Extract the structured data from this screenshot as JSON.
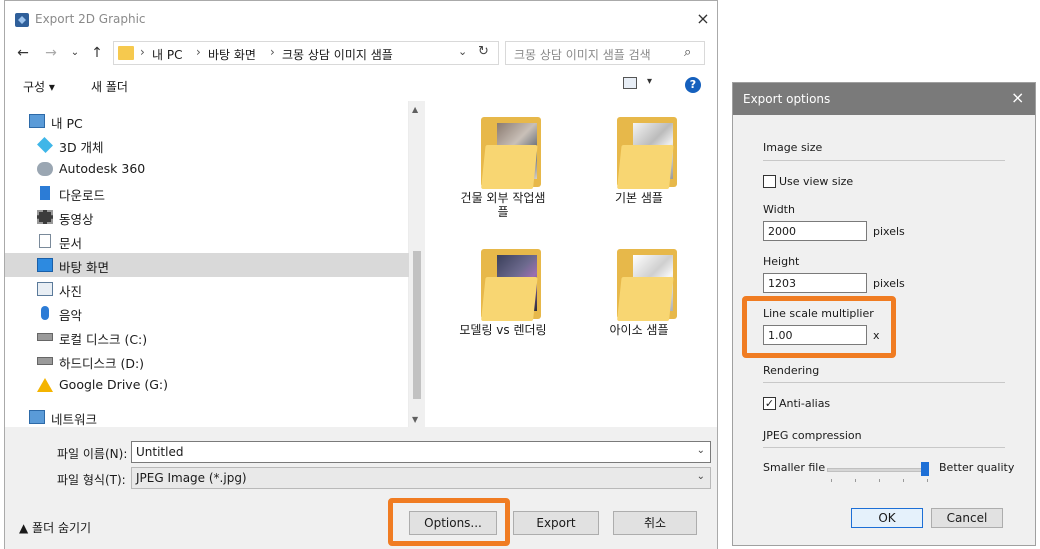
{
  "main_dialog": {
    "title": "Export 2D Graphic",
    "close_glyph": "×",
    "nav": {
      "back": "←",
      "forward": "→",
      "dropdown": "⌄",
      "up": "↑"
    },
    "address": {
      "crumbs": [
        "내 PC",
        "바탕 화면",
        "크몽 상담 이미지 샘플"
      ],
      "sep": "›",
      "dropdown": "⌄",
      "refresh": "↻"
    },
    "search_placeholder": "크몽 상담 이미지 샘플 검색",
    "search_icon": "⌕",
    "toolbar": {
      "organize": "구성 ▾",
      "new_folder": "새 폴더",
      "view_dropdown": "▾",
      "help": "?"
    },
    "sidebar": [
      {
        "label": "내 PC",
        "icon": "computer-icon"
      },
      {
        "label": "3D 개체",
        "icon": "cube-icon"
      },
      {
        "label": "Autodesk 360",
        "icon": "cloud-icon"
      },
      {
        "label": "다운로드",
        "icon": "download-icon"
      },
      {
        "label": "동영상",
        "icon": "video-icon"
      },
      {
        "label": "문서",
        "icon": "document-icon"
      },
      {
        "label": "바탕 화면",
        "icon": "desktop-icon"
      },
      {
        "label": "사진",
        "icon": "picture-icon"
      },
      {
        "label": "음악",
        "icon": "music-icon"
      },
      {
        "label": "로컬 디스크 (C:)",
        "icon": "disk-icon"
      },
      {
        "label": "하드디스크 (D:)",
        "icon": "disk-icon"
      },
      {
        "label": "Google Drive (G:)",
        "icon": "google-drive-icon"
      },
      {
        "label": "네트워크",
        "icon": "network-icon"
      }
    ],
    "selected_sidebar": "바탕 화면",
    "scroll": {
      "up": "▲",
      "down": "▼"
    },
    "files": [
      {
        "label1": "건물 외부 작업샘",
        "label2": "플"
      },
      {
        "label1": "기본 샘플",
        "label2": ""
      },
      {
        "label1": "모델링 vs 렌더링",
        "label2": ""
      },
      {
        "label1": "아이소 샘플",
        "label2": ""
      }
    ],
    "filename_label": "파일 이름(N):",
    "filename_value": "Untitled",
    "filetype_label": "파일 형식(T):",
    "filetype_value": "JPEG Image (*.jpg)",
    "dropdown_arrow": "⌄",
    "hide_folders": "▲  폴더 숨기기",
    "buttons": {
      "options": "Options...",
      "export": "Export",
      "cancel": "취소"
    }
  },
  "export_options": {
    "title": "Export options",
    "close_glyph": "×",
    "image_size_heading": "Image size",
    "use_view_size_label": "Use view size",
    "use_view_size_checked": false,
    "width_label": "Width",
    "width_value": "2000",
    "width_unit": "pixels",
    "height_label": "Height",
    "height_value": "1203",
    "height_unit": "pixels",
    "line_scale_label": "Line scale multiplier",
    "line_scale_value": "1.00",
    "line_scale_unit": "x",
    "rendering_heading": "Rendering",
    "anti_alias_label": "Anti-alias",
    "anti_alias_checked": true,
    "check_glyph": "✓",
    "jpeg_heading": "JPEG compression",
    "slider_left": "Smaller file",
    "slider_right": "Better quality",
    "slider_level": 1.0,
    "ok": "OK",
    "cancel": "Cancel"
  },
  "colors": {
    "highlight": "#f07c22",
    "selection": "#d9d9d9",
    "accent": "#1d6fd6"
  }
}
